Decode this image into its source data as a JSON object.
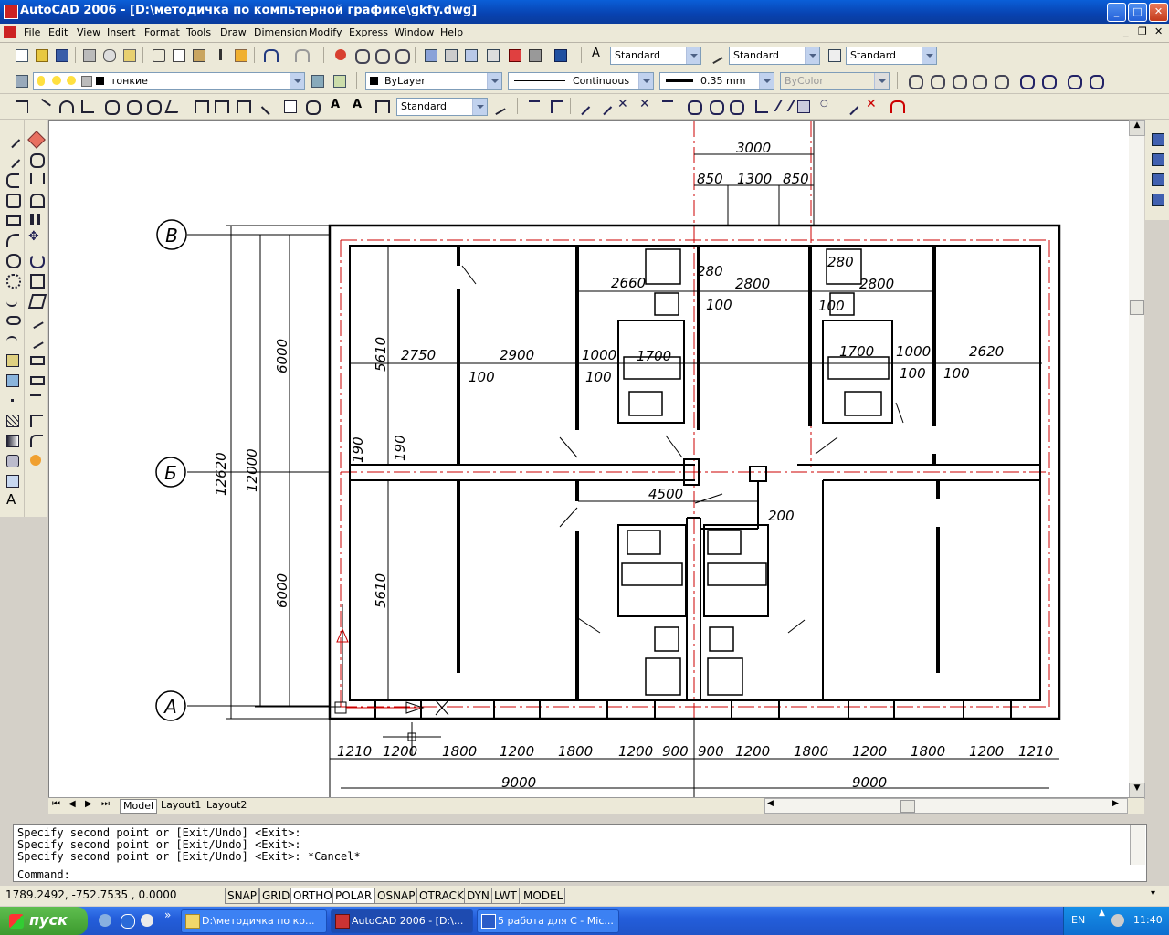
{
  "window": {
    "title": "AutoCAD 2006 - [D:\\методичка по компьтерной графике\\gkfy.dwg]"
  },
  "menu": [
    "File",
    "Edit",
    "View",
    "Insert",
    "Format",
    "Tools",
    "Draw",
    "Dimension",
    "Modify",
    "Express",
    "Window",
    "Help"
  ],
  "toolbar1": {
    "text_style": "Standard",
    "dim_style": "Standard",
    "table_style": "Standard"
  },
  "toolbar2": {
    "layer": "тонкие",
    "color": "ByLayer",
    "linetype": "Continuous",
    "lineweight": "0.35 mm",
    "plotstyle": "ByColor"
  },
  "toolbar3": {
    "dimstyle": "Standard"
  },
  "drawing": {
    "axis_labels": [
      "В",
      "Б",
      "А"
    ],
    "dims_top": [
      "3000",
      "850",
      "1300",
      "850"
    ],
    "dims_plan": [
      "2660",
      "280",
      "2800",
      "280",
      "2800",
      "100",
      "100",
      "1000",
      "1700",
      "1700",
      "1000",
      "2750",
      "2900",
      "2620",
      "100",
      "100",
      "100",
      "100",
      "4500",
      "200",
      "5610",
      "5610",
      "190",
      "190"
    ],
    "dims_left": [
      "12620",
      "12000",
      "6000",
      "6000"
    ],
    "dims_bottom": [
      "1210",
      "1200",
      "1800",
      "1200",
      "1800",
      "1200",
      "900",
      "900",
      "1200",
      "1800",
      "1200",
      "1800",
      "1200",
      "1210"
    ],
    "dims_bottom_total": [
      "9000",
      "9000"
    ]
  },
  "tabs": {
    "model": "Model",
    "layout1": "Layout1",
    "layout2": "Layout2"
  },
  "command": {
    "line1": "Specify second point or [Exit/Undo] <Exit>:",
    "line2": "Specify second point or [Exit/Undo] <Exit>:",
    "line3": "Specify second point or [Exit/Undo] <Exit>: *Cancel*",
    "prompt": "Command:"
  },
  "status": {
    "coords": "1789.2492, -752.7535 , 0.0000",
    "buttons": [
      "SNAP",
      "GRID",
      "ORTHO",
      "POLAR",
      "OSNAP",
      "OTRACK",
      "DYN",
      "LWT",
      "MODEL"
    ]
  },
  "taskbar": {
    "start": "пуск",
    "tasks": [
      "D:\\методичка по ко...",
      "AutoCAD 2006 - [D:\\...",
      "5 работа для С - Mic..."
    ],
    "lang": "EN",
    "clock": "11:40"
  },
  "colors": {
    "titlebar": "#0a5fd8",
    "axis_red": "#cc0000",
    "taskbar": "#245edb",
    "start": "#3c9a2e"
  }
}
